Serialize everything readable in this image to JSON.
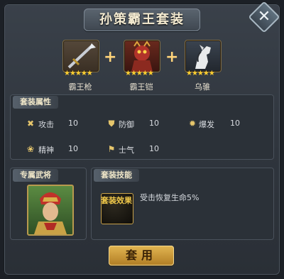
{
  "title": "孙策霸王套装",
  "close_label": "✕",
  "items": [
    {
      "name": "霸王枪",
      "stars": "★★★★★",
      "icon": "spear-icon"
    },
    {
      "name": "霸王铠",
      "stars": "★★★★★",
      "icon": "armor-icon"
    },
    {
      "name": "乌骓",
      "stars": "★★★★★",
      "icon": "horse-icon"
    }
  ],
  "plus": "+",
  "attributes": {
    "header": "套装属性",
    "list": [
      {
        "label": "攻击",
        "value": "10",
        "icon": "attack-icon"
      },
      {
        "label": "防御",
        "value": "10",
        "icon": "defense-icon"
      },
      {
        "label": "爆发",
        "value": "10",
        "icon": "burst-icon"
      },
      {
        "label": "精神",
        "value": "10",
        "icon": "spirit-icon"
      },
      {
        "label": "士气",
        "value": "10",
        "icon": "morale-icon"
      }
    ]
  },
  "exclusive_general": {
    "header": "专属武将"
  },
  "set_skill": {
    "header": "套装技能",
    "badge": "套装效果",
    "description": "受击恢复生命5%"
  },
  "use_button": "套用",
  "colors": {
    "gold": "#e3b652",
    "star": "#ffcf2f",
    "panel": "#2f353d"
  }
}
